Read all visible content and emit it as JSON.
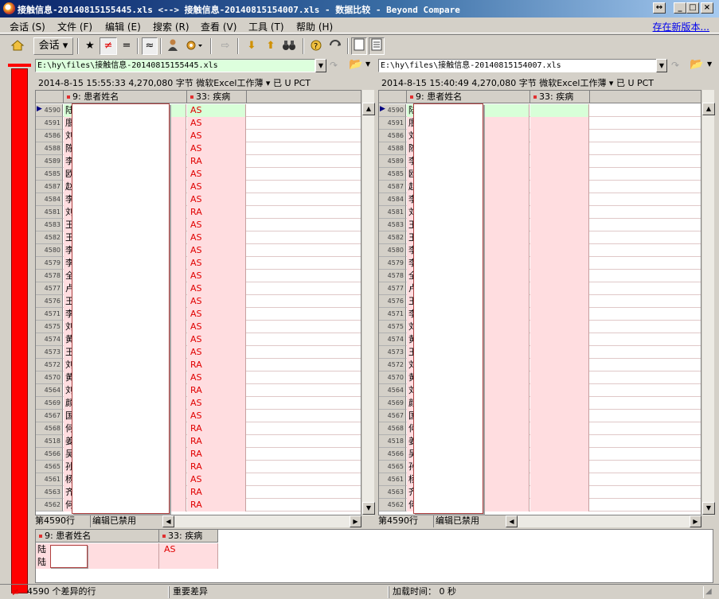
{
  "window": {
    "title": "接触信息-20140815155445.xls <--> 接触信息-20140815154007.xls - 数据比较 - Beyond Compare",
    "controls": [
      "↔",
      "_",
      "□",
      "×"
    ]
  },
  "menu": {
    "items": [
      "会话 (S)",
      "文件 (F)",
      "编辑 (E)",
      "搜索 (R)",
      "查看 (V)",
      "工具 (T)",
      "帮助 (H)"
    ],
    "new_version_link": "存在新版本..."
  },
  "toolbar": {
    "session_label": "会话",
    "buttons": [
      "★",
      "≠",
      "=",
      "≈"
    ]
  },
  "left": {
    "path": "E:\\hy\\files\\接触信息-20140815155445.xls",
    "info": "2014-8-15 15:55:33   4,270,080 字节   微软Excel工作薄 ▾ 已  U   PCT",
    "status_row": "第4590行",
    "status_edit": "编辑已禁用"
  },
  "right": {
    "path": "E:\\hy\\files\\接触信息-20140815154007.xls",
    "info": "2014-8-15 15:40:49   4,270,080 字节   微软Excel工作薄 ▾ 已  U   PCT",
    "status_row": "第4590行",
    "status_edit": "编辑已禁用"
  },
  "columns": {
    "name": "9: 患者姓名",
    "disease": "33: 疾病"
  },
  "rows": [
    {
      "n": "4590",
      "name": "陆",
      "d": "AS"
    },
    {
      "n": "4591",
      "name": "廖",
      "d": "AS"
    },
    {
      "n": "4586",
      "name": "刘",
      "d": "AS"
    },
    {
      "n": "4588",
      "name": "陈",
      "d": "AS"
    },
    {
      "n": "4589",
      "name": "李",
      "d": "RA"
    },
    {
      "n": "4585",
      "name": "欧",
      "d": "AS"
    },
    {
      "n": "4587",
      "name": "赵",
      "d": "AS"
    },
    {
      "n": "4584",
      "name": "李",
      "d": "AS"
    },
    {
      "n": "4581",
      "name": "刘",
      "d": "RA"
    },
    {
      "n": "4583",
      "name": "王",
      "d": "AS"
    },
    {
      "n": "4582",
      "name": "王",
      "d": "AS"
    },
    {
      "n": "4580",
      "name": "李",
      "d": "AS"
    },
    {
      "n": "4579",
      "name": "李",
      "d": "AS"
    },
    {
      "n": "4578",
      "name": "全",
      "d": "AS"
    },
    {
      "n": "4577",
      "name": "卢",
      "d": "AS"
    },
    {
      "n": "4576",
      "name": "王",
      "d": "AS"
    },
    {
      "n": "4571",
      "name": "李",
      "d": "AS"
    },
    {
      "n": "4575",
      "name": "刘",
      "d": "AS"
    },
    {
      "n": "4574",
      "name": "黄",
      "d": "AS"
    },
    {
      "n": "4573",
      "name": "王",
      "d": "AS"
    },
    {
      "n": "4572",
      "name": "刘",
      "d": "RA"
    },
    {
      "n": "4570",
      "name": "黄",
      "d": "AS"
    },
    {
      "n": "4564",
      "name": "刘",
      "d": "RA"
    },
    {
      "n": "4569",
      "name": "颜",
      "d": "AS"
    },
    {
      "n": "4567",
      "name": "国",
      "d": "AS"
    },
    {
      "n": "4568",
      "name": "何",
      "d": "RA"
    },
    {
      "n": "4518",
      "name": "姜",
      "d": "RA"
    },
    {
      "n": "4566",
      "name": "吴",
      "d": "RA"
    },
    {
      "n": "4565",
      "name": "孙",
      "d": "RA"
    },
    {
      "n": "4561",
      "name": "杨",
      "d": "AS"
    },
    {
      "n": "4563",
      "name": "齐",
      "d": "RA"
    },
    {
      "n": "4562",
      "name": "何",
      "d": "RA"
    }
  ],
  "detail": {
    "row1_label": "陆",
    "row1_disease": "AS",
    "row2_label": "陆"
  },
  "statusbar": {
    "diff_count": "4590 个差异的行",
    "diff_type": "重要差异",
    "load_time": "加载时间： 0 秒"
  }
}
